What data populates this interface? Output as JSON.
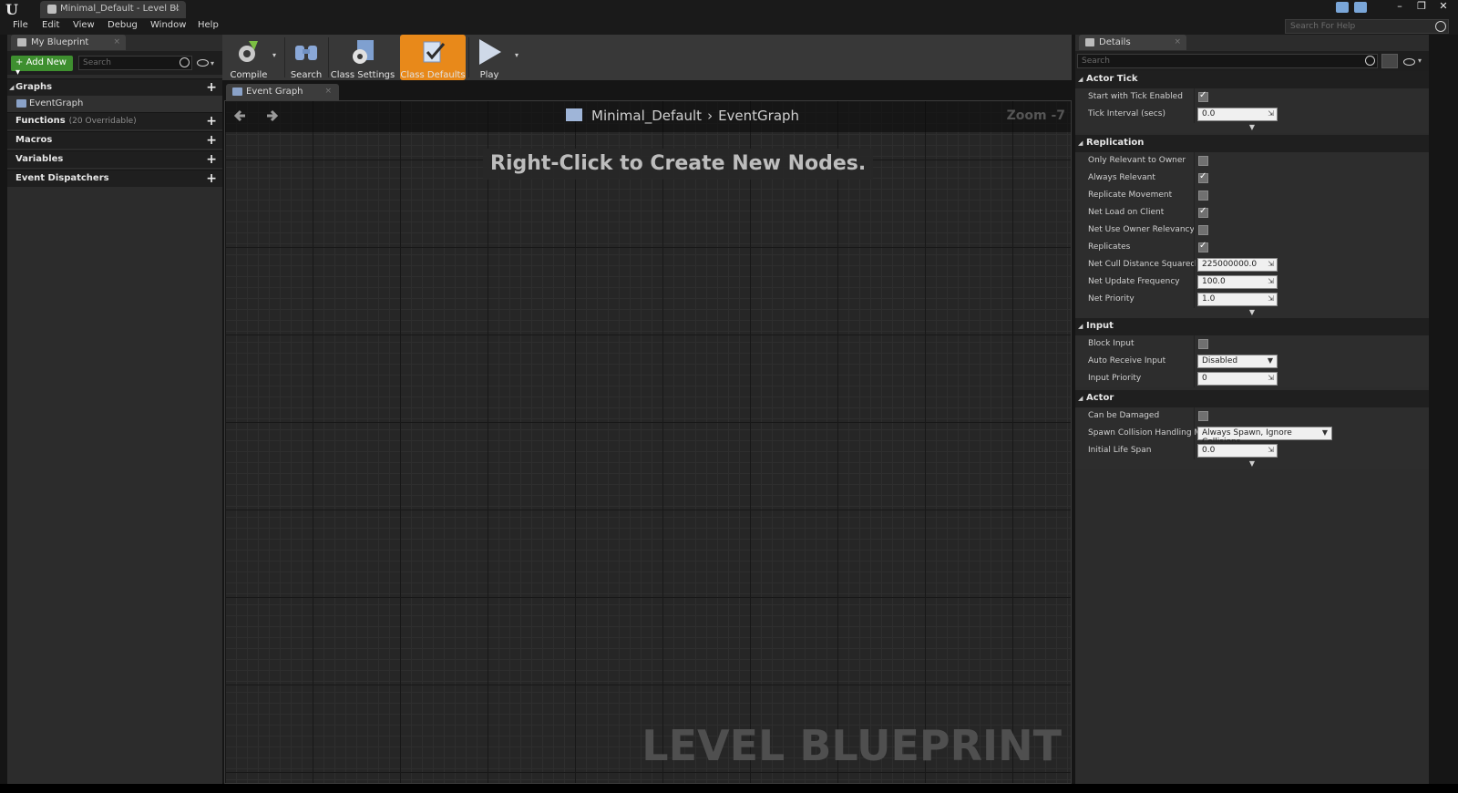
{
  "window": {
    "tab_title": "Minimal_Default - Level Bl",
    "close_glyph": "×",
    "minimize_glyph": "–",
    "maximize_glyph": "❐",
    "exit_glyph": "✕"
  },
  "menu": {
    "items": [
      "File",
      "Edit",
      "View",
      "Debug",
      "Window",
      "Help"
    ],
    "help_search_placeholder": "Search For Help"
  },
  "left_panel": {
    "tab_label": "My Blueprint",
    "add_new_label": "Add New",
    "search_placeholder": "Search",
    "sections": {
      "graphs": "Graphs",
      "event_graph": "EventGraph",
      "functions": "Functions",
      "functions_sub": "(20 Overridable)",
      "macros": "Macros",
      "variables": "Variables",
      "event_dispatchers": "Event Dispatchers"
    }
  },
  "toolbar": {
    "compile": "Compile",
    "search": "Search",
    "class_settings": "Class Settings",
    "class_defaults": "Class Defaults",
    "play": "Play",
    "accent_color": "#e8891a"
  },
  "graph": {
    "tab_label": "Event Graph",
    "breadcrumb_root": "Minimal_Default",
    "breadcrumb_leaf": "EventGraph",
    "zoom": "Zoom -7",
    "hint": "Right-Click to Create New Nodes.",
    "watermark": "LEVEL BLUEPRINT"
  },
  "details": {
    "tab_label": "Details",
    "search_placeholder": "Search",
    "categories": {
      "actor_tick": "Actor Tick",
      "replication": "Replication",
      "input": "Input",
      "actor": "Actor"
    },
    "props": {
      "start_with_tick": "Start with Tick Enabled",
      "tick_interval": "Tick Interval (secs)",
      "tick_interval_val": "0.0",
      "only_relevant_owner": "Only Relevant to Owner",
      "always_relevant": "Always Relevant",
      "replicate_movement": "Replicate Movement",
      "net_load_on_client": "Net Load on Client",
      "net_use_owner_relevancy": "Net Use Owner Relevancy",
      "replicates": "Replicates",
      "net_cull_distance": "Net Cull Distance Squared",
      "net_cull_distance_val": "225000000.0",
      "net_update_freq": "Net Update Frequency",
      "net_update_freq_val": "100.0",
      "net_priority": "Net Priority",
      "net_priority_val": "1.0",
      "block_input": "Block Input",
      "auto_receive_input": "Auto Receive Input",
      "auto_receive_input_val": "Disabled",
      "input_priority": "Input Priority",
      "input_priority_val": "0",
      "can_be_damaged": "Can be Damaged",
      "spawn_collision": "Spawn Collision Handling Me",
      "spawn_collision_val": "Always Spawn, Ignore Collisions",
      "initial_life_span": "Initial Life Span",
      "initial_life_span_val": "0.0"
    }
  }
}
